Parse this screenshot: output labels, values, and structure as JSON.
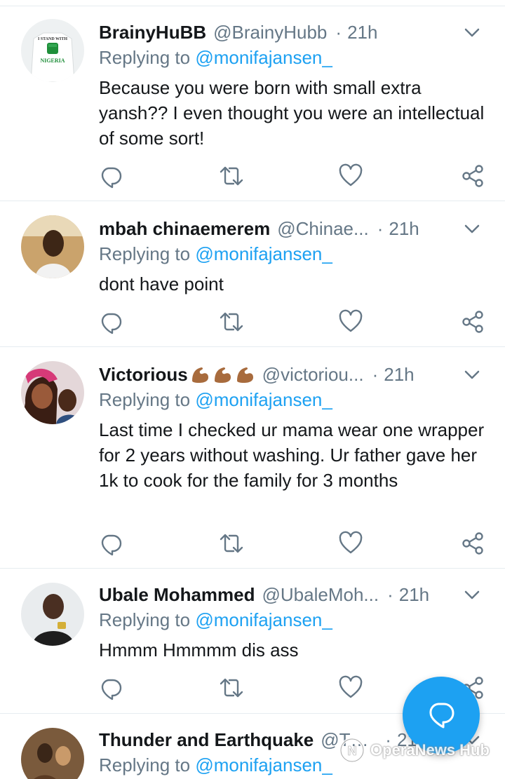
{
  "colors": {
    "accent": "#1da1f2",
    "text": "#14171a",
    "muted": "#657786",
    "divider": "#e6ecf0"
  },
  "tweets": [
    {
      "name": "BrainyHuBB",
      "handle": "@BrainyHubb",
      "dot": "·",
      "time": "21h",
      "replying_prefix": "Replying to ",
      "mention": "@monifajansen_",
      "text": "Because you were born with small extra yansh?? I even thought you were an intellectual of some sort!",
      "avatar_text_top": "I STAND WITH",
      "avatar_text_bottom": "NIGERIA"
    },
    {
      "name": "mbah chinaemerem",
      "handle": "@Chinae...",
      "dot": "·",
      "time": "21h",
      "replying_prefix": "Replying to ",
      "mention": "@monifajansen_",
      "text": "dont have point"
    },
    {
      "name": "Victorious",
      "name_emoji": [
        "flexed-biceps",
        "flexed-biceps",
        "flexed-biceps"
      ],
      "handle": "@victoriou...",
      "dot": "·",
      "time": "21h",
      "replying_prefix": "Replying to ",
      "mention": "@monifajansen_",
      "text": "Last time I checked ur mama wear one wrapper for 2 years without washing. Ur father gave her 1k to cook for the family for 3 months"
    },
    {
      "name": "Ubale Mohammed",
      "handle": "@UbaleMoh...",
      "dot": "·",
      "time": "21h",
      "replying_prefix": "Replying to ",
      "mention": "@monifajansen_",
      "text": "Hmmm Hmmmm dis ass"
    },
    {
      "name": "Thunder and Earthquake",
      "handle": "@Thunder...",
      "dot": "·",
      "time": "21h",
      "replying_prefix": "Replying to ",
      "mention": "@monifajansen_",
      "text": ""
    }
  ],
  "icons": {
    "reply": "reply-icon",
    "retweet": "retweet-icon",
    "like": "like-icon",
    "share": "share-icon",
    "more": "chevron-down-icon",
    "compose": "compose-reply-icon"
  },
  "watermark": {
    "text": "OperaNews Hub"
  }
}
